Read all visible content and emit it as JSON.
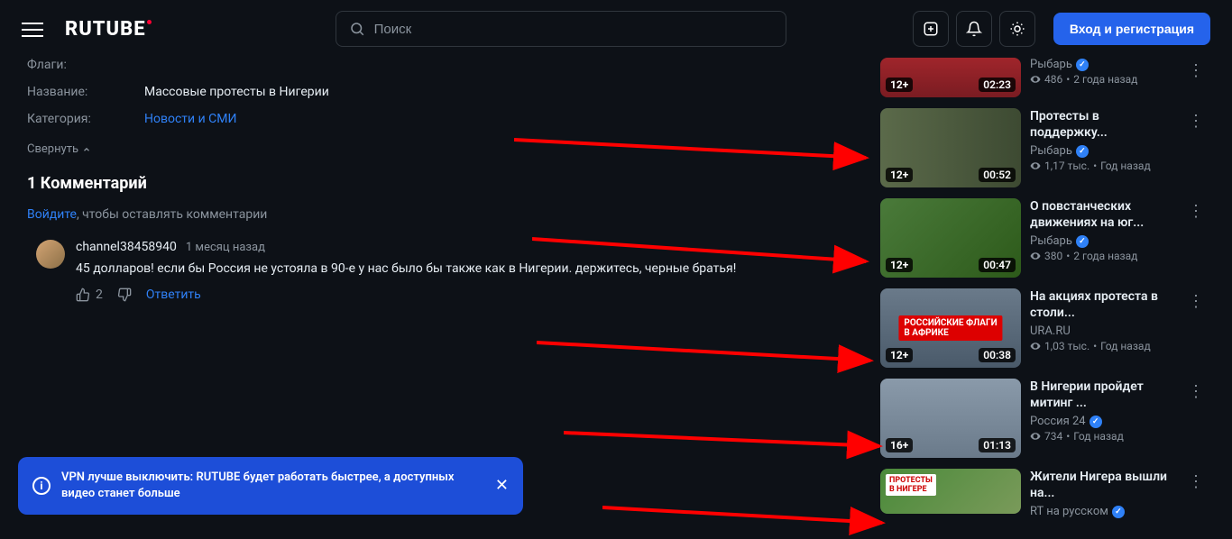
{
  "header": {
    "logo": "RUTUBE",
    "search_placeholder": "Поиск",
    "login_button": "Вход и регистрация"
  },
  "meta": {
    "flags_label": "Флаги:",
    "name_label": "Название:",
    "name_value": "Массовые протесты в Нигерии",
    "category_label": "Категория:",
    "category_value": "Новости и СМИ",
    "collapse": "Свернуть"
  },
  "comments": {
    "title": "1 Комментарий",
    "login_link": "Войдите",
    "login_rest": ", чтобы оставлять комментарии",
    "items": [
      {
        "author": "channel38458940",
        "time": "1 месяц назад",
        "text": "45 долларов! если бы Россия не устояла в 90-е у нас было бы также как в Нигерии. держитесь, черные братья!",
        "likes": "2",
        "reply": "Ответить"
      }
    ]
  },
  "recommended": [
    {
      "title": "",
      "channel": "Рыбарь",
      "verified": true,
      "views": "486",
      "age": "2 года назад",
      "badge": "12+",
      "duration": "02:23",
      "partial": true
    },
    {
      "title": "Протесты в поддержку...",
      "channel": "Рыбарь",
      "verified": true,
      "views": "1,17 тыс.",
      "age": "Год назад",
      "badge": "12+",
      "duration": "00:52"
    },
    {
      "title": "О повстанческих движениях на юг...",
      "channel": "Рыбарь",
      "verified": true,
      "views": "380",
      "age": "2 года назад",
      "badge": "12+",
      "duration": "00:47"
    },
    {
      "title": "На акциях протеста в столи...",
      "channel": "URA.RU",
      "verified": false,
      "views": "1,03 тыс.",
      "age": "Год назад",
      "badge": "12+",
      "duration": "00:38"
    },
    {
      "title": "В Нигерии пройдет митинг ...",
      "channel": "Россия 24",
      "verified": true,
      "views": "734",
      "age": "Год назад",
      "badge": "16+",
      "duration": "01:13"
    },
    {
      "title": "Жители Нигера вышли на...",
      "channel": "RT на русском",
      "verified": true,
      "views": "",
      "age": "",
      "badge": "",
      "duration": "",
      "partial_bottom": true
    }
  ],
  "toast": {
    "text": "VPN лучше выключить: RUTUBE будет работать быстрее, а доступных видео станет больше"
  }
}
